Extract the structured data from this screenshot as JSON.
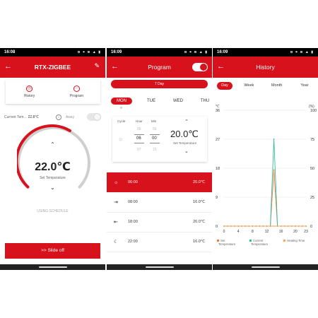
{
  "status": {
    "time1": "16:08",
    "time2": "16:09",
    "time3": "16:09",
    "icons": "⊖ ⌖ ≋ ▲ ▮"
  },
  "screen1": {
    "title": "RTX-ZIGBEE",
    "tabs": [
      {
        "label": "History",
        "icon": "clock-icon"
      },
      {
        "label": "Program",
        "icon": "dots-icon"
      }
    ],
    "current_label": "Current Tem...",
    "current_value": "22.8℃",
    "away_label": "Away",
    "setpoint": "22.0℃",
    "setpoint_label": "Set Temperature",
    "schedule_text": "USING SCHEDULE",
    "slide_button": ">>  Slide off",
    "accent": "#d8121c"
  },
  "screen2": {
    "title": "Program",
    "mode_button": "7 Day",
    "days": [
      "MON",
      "TUE",
      "WED",
      "THU"
    ],
    "selected_day": "MON",
    "editor": {
      "headers": {
        "cycle": "Cycle",
        "hour": "Hour",
        "min": "Min"
      },
      "hour_prev": "05",
      "hour": "06",
      "hour_next": "07",
      "min_prev": "55",
      "min": "00",
      "min_next": "15",
      "temperature": "20.0℃",
      "temperature_label": "Set Temperature"
    },
    "periods": [
      {
        "icon": "sunrise-icon",
        "time": "06:00",
        "temp": "20.0℃"
      },
      {
        "icon": "door-out-icon",
        "time": "08:00",
        "temp": "16.0℃"
      },
      {
        "icon": "door-in-icon",
        "time": "18:00",
        "temp": "20.0℃"
      },
      {
        "icon": "moon-icon",
        "time": "22:00",
        "temp": "16.0℃"
      }
    ]
  },
  "screen3": {
    "title": "History",
    "tabs": [
      "Day",
      "Week",
      "Month",
      "Year"
    ],
    "selected_tab": "Day"
  },
  "chart_data": {
    "type": "line",
    "left_unit": "℃",
    "right_unit": "(%)",
    "left_ticks": [
      0,
      9,
      18,
      27,
      36
    ],
    "right_ticks": [
      0,
      25,
      50,
      75,
      100
    ],
    "x_ticks": [
      0,
      4,
      8,
      12,
      16,
      20,
      23
    ],
    "ylim": [
      0,
      36
    ],
    "xlim": [
      0,
      23
    ],
    "grid": true,
    "legend_position": "bottom",
    "series": [
      {
        "name": "Set Temperature",
        "color": "#f07a3c",
        "axis": "left",
        "x": [
          0,
          1,
          2,
          3,
          4,
          5,
          6,
          7,
          8,
          9,
          10,
          11,
          12,
          13,
          14,
          15,
          16,
          17,
          18,
          19,
          20,
          21,
          22,
          23
        ],
        "y": [
          0,
          0,
          0,
          0,
          0,
          0,
          0,
          0,
          0,
          0,
          0,
          0,
          0,
          0,
          17.5,
          0,
          0,
          0,
          0,
          0,
          0,
          0,
          0,
          0
        ]
      },
      {
        "name": "Current Temperature",
        "color": "#2bbf9a",
        "axis": "left",
        "x": [
          0,
          1,
          2,
          3,
          4,
          5,
          6,
          7,
          8,
          9,
          10,
          11,
          12,
          13,
          14,
          15,
          16,
          17,
          18,
          19,
          20,
          21,
          22,
          23
        ],
        "y": [
          0,
          0,
          0,
          0,
          0,
          0,
          0,
          0,
          0,
          0,
          0,
          0,
          0,
          0,
          27,
          0,
          0,
          0,
          0,
          0,
          0,
          0,
          0,
          0
        ]
      },
      {
        "name": "Heating Time",
        "color": "#f5a55a",
        "axis": "right",
        "x": [
          0,
          1,
          2,
          3,
          4,
          5,
          6,
          7,
          8,
          9,
          10,
          11,
          12,
          13,
          14,
          15,
          16,
          17,
          18,
          19,
          20,
          21,
          22,
          23
        ],
        "y": [
          0,
          0,
          0,
          0,
          0,
          0,
          0,
          0,
          0,
          0,
          0,
          0,
          0,
          0,
          0,
          0,
          0,
          0,
          0,
          0,
          0,
          0,
          0,
          0
        ]
      }
    ]
  }
}
